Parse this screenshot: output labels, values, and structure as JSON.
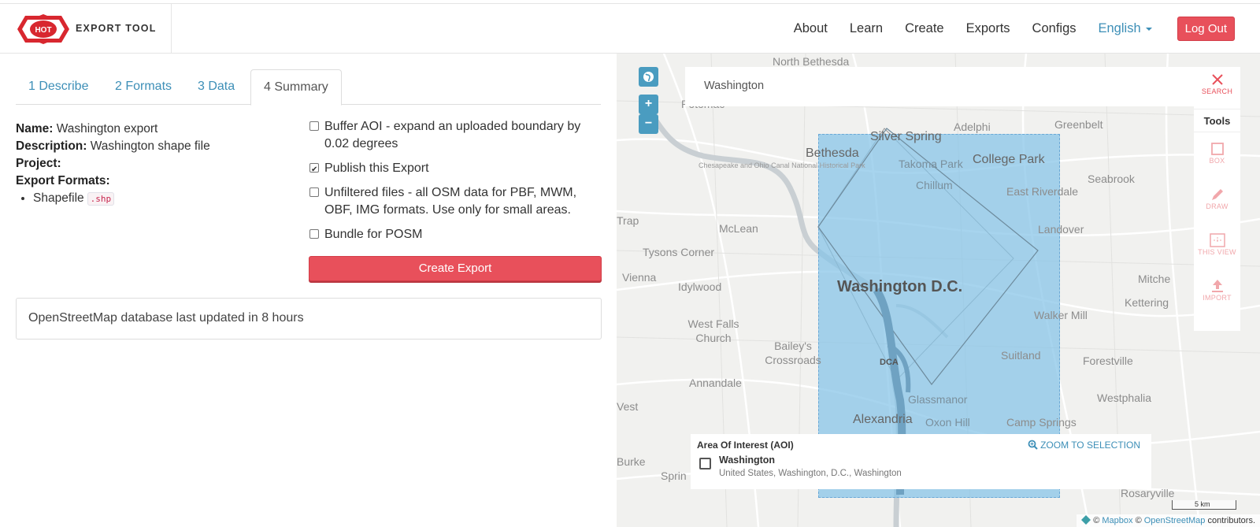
{
  "navbar": {
    "brand_badge": "HOT",
    "brand_title": "EXPORT TOOL",
    "items": [
      {
        "label": "About"
      },
      {
        "label": "Learn"
      },
      {
        "label": "Create"
      },
      {
        "label": "Exports"
      },
      {
        "label": "Configs"
      }
    ],
    "language": "English",
    "logout": "Log Out"
  },
  "tabs": [
    {
      "label": "1 Describe"
    },
    {
      "label": "2 Formats"
    },
    {
      "label": "3 Data"
    },
    {
      "label": "4 Summary",
      "active": true
    }
  ],
  "summary": {
    "name_label": "Name:",
    "name_value": "Washington export",
    "description_label": "Description:",
    "description_value": "Washington shape file",
    "project_label": "Project:",
    "project_value": "",
    "formats_label": "Export Formats:",
    "formats": [
      {
        "name": "Shapefile",
        "ext": ".shp"
      }
    ]
  },
  "options": [
    {
      "label": "Buffer AOI - expand an uploaded boundary by 0.02 degrees",
      "checked": false
    },
    {
      "label": "Publish this Export",
      "checked": true
    },
    {
      "label": "Unfiltered files - all OSM data for PBF, MWM, OBF, IMG formats. Use only for small areas.",
      "checked": false
    },
    {
      "label": "Bundle for POSM",
      "checked": false
    }
  ],
  "create_button": "Create Export",
  "status": "OpenStreetMap database last updated in 8 hours",
  "map": {
    "search_value": "Washington",
    "zoom_in": "+",
    "zoom_out": "−",
    "tools": {
      "search_label": "SEARCH",
      "title": "Tools",
      "box_label": "BOX",
      "draw_label": "DRAW",
      "this_view_label": "THIS VIEW",
      "import_label": "IMPORT"
    },
    "labels": {
      "north_bethesda": "North Bethesda",
      "potomac": "Potomac",
      "adelphi": "Adelphi",
      "greenbelt": "Greenbelt",
      "silver_spring": "Silver Spring",
      "bethesda": "Bethesda",
      "takoma_park": "Takoma Park",
      "college_park": "College Park",
      "chesapeake": "Chesapeake and Ohio Canal National Historical Park",
      "chillum": "Chillum",
      "seabrook": "Seabrook",
      "east_riverdale": "East Riverdale",
      "trap": "Trap",
      "mclean": "McLean",
      "landover": "Landover",
      "tysons": "Tysons Corner",
      "vienna": "Vienna",
      "idylwood": "Idylwood",
      "washington_dc": "Washington D.C.",
      "mitche": "Mitche",
      "kettering": "Kettering",
      "west_falls_church": "West Falls Church",
      "walker_mill": "Walker Mill",
      "baileys": "Bailey's Crossroads",
      "dca": "DCA",
      "suitland": "Suitland",
      "forestville": "Forestville",
      "annandale": "Annandale",
      "glassmanor": "Glassmanor",
      "westphalia": "Westphalia",
      "west": "Vest",
      "alexandria": "Alexandria",
      "oxon_hill": "Oxon Hill",
      "camp_springs": "Camp Springs",
      "burke": "Burke",
      "spring": "Sprin",
      "rosaryville": "Rosaryville"
    },
    "aoi_panel": {
      "title": "Area Of Interest (AOI)",
      "zoom_link": "ZOOM TO SELECTION",
      "name": "Washington",
      "description": "United States, Washington, D.C., Washington"
    },
    "scale": "5 km",
    "attribution": {
      "copy1": "©",
      "mapbox": "Mapbox",
      "copy2": "©",
      "osm": "OpenStreetMap",
      "suffix": "contributors."
    }
  },
  "colors": {
    "accent": "#e8505b",
    "link": "#3d8fb7",
    "aoi_fill": "#85c4e8"
  }
}
